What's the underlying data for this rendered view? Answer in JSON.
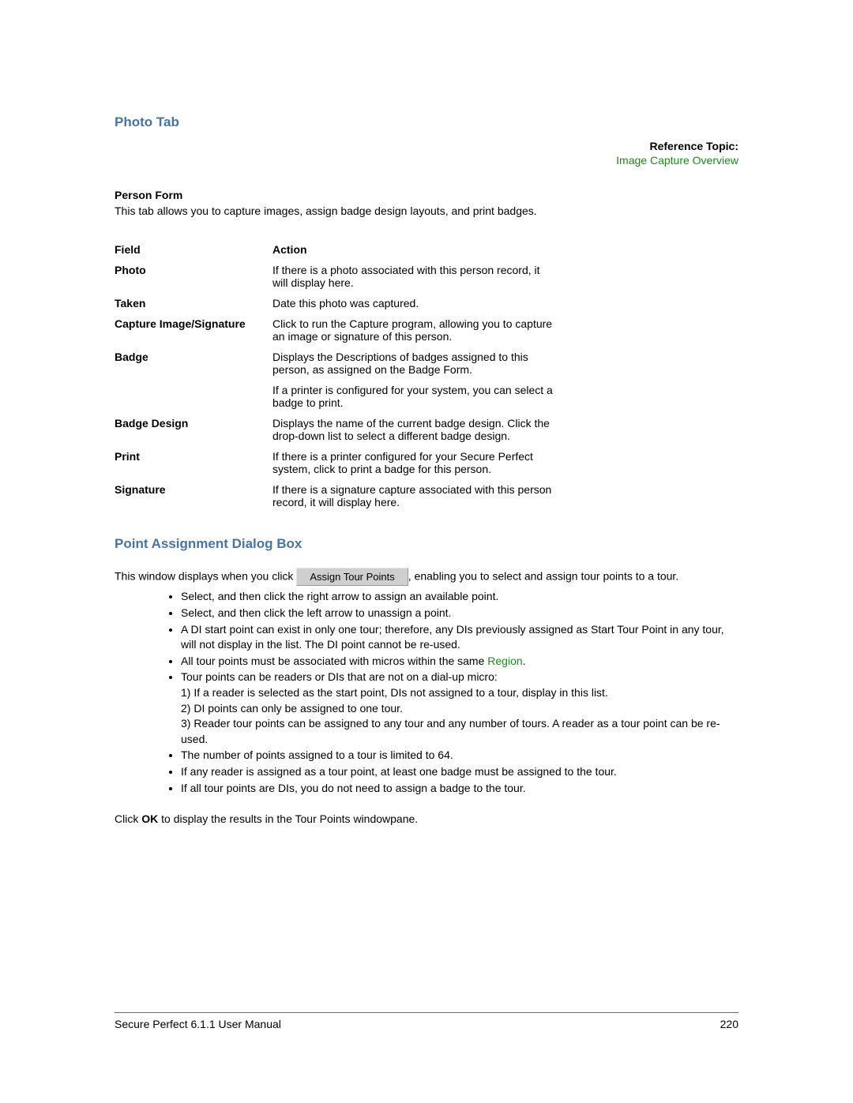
{
  "section1": {
    "title": "Photo Tab",
    "ref_label": "Reference Topic:",
    "ref_link": "Image Capture Overview",
    "subhead": "Person Form",
    "intro": "This tab allows you to capture images, assign badge design layouts, and print badges.",
    "table_header": {
      "field": "Field",
      "action": "Action"
    },
    "rows": [
      {
        "field": "Photo",
        "action": "If there is a photo associated with this person record, it will display here."
      },
      {
        "field": "Taken",
        "action": "Date this photo was captured."
      },
      {
        "field": "Capture Image/Signature",
        "action": "Click to run the Capture program, allowing you to capture an image or signature of this person."
      },
      {
        "field": "Badge",
        "action": "Displays the Descriptions of badges assigned to this person, as assigned on the Badge Form."
      },
      {
        "field": "",
        "action": "If a printer is configured for your system, you can select a badge to print."
      },
      {
        "field": "Badge Design",
        "action": "Displays the name of the current badge design. Click the drop-down list to select a different badge design."
      },
      {
        "field": "Print",
        "action": "If there is a printer configured for your Secure Perfect system, click to print a badge for this person."
      },
      {
        "field": "Signature",
        "action": "If there is a signature capture associated with this person record, it will display here."
      }
    ]
  },
  "section2": {
    "title": "Point Assignment Dialog Box",
    "para_pre": "This window displays when you click ",
    "button": "Assign Tour Points",
    "para_post": ", enabling you to select and assign tour points to a tour.",
    "bullets": [
      "Select, and then click the right arrow to assign an available point.",
      "Select, and then click the left arrow to unassign a point.",
      "A DI start point can exist in only one tour; therefore, any DIs previously assigned as Start Tour Point in any tour, will not display in the list. The DI point cannot be re-used."
    ],
    "bullet_region_pre": "All tour points must be associated with micros within the same ",
    "bullet_region_link": "Region",
    "bullet_region_post": ".",
    "bullet_tour": "Tour points can be readers or DIs that are not on a dial-up micro:",
    "bullet_tour_sub": [
      "1) If a reader is selected as the start point, DIs not assigned to a tour, display in this list.",
      "2) DI points can only be assigned to one tour.",
      "3) Reader tour points can be assigned to any tour and any number of tours. A reader as a tour point can be re-used."
    ],
    "bullets2": [
      "The number of points assigned to a tour is limited to 64.",
      "If any reader is assigned as a tour point, at least one badge must be assigned to the tour.",
      "If all tour points are DIs, you do not need to assign a badge to the tour."
    ],
    "final_pre": "Click ",
    "final_bold": "OK",
    "final_post": " to display the results in the Tour Points windowpane."
  },
  "footer": {
    "left": "Secure Perfect 6.1.1 User Manual",
    "right": "220"
  }
}
